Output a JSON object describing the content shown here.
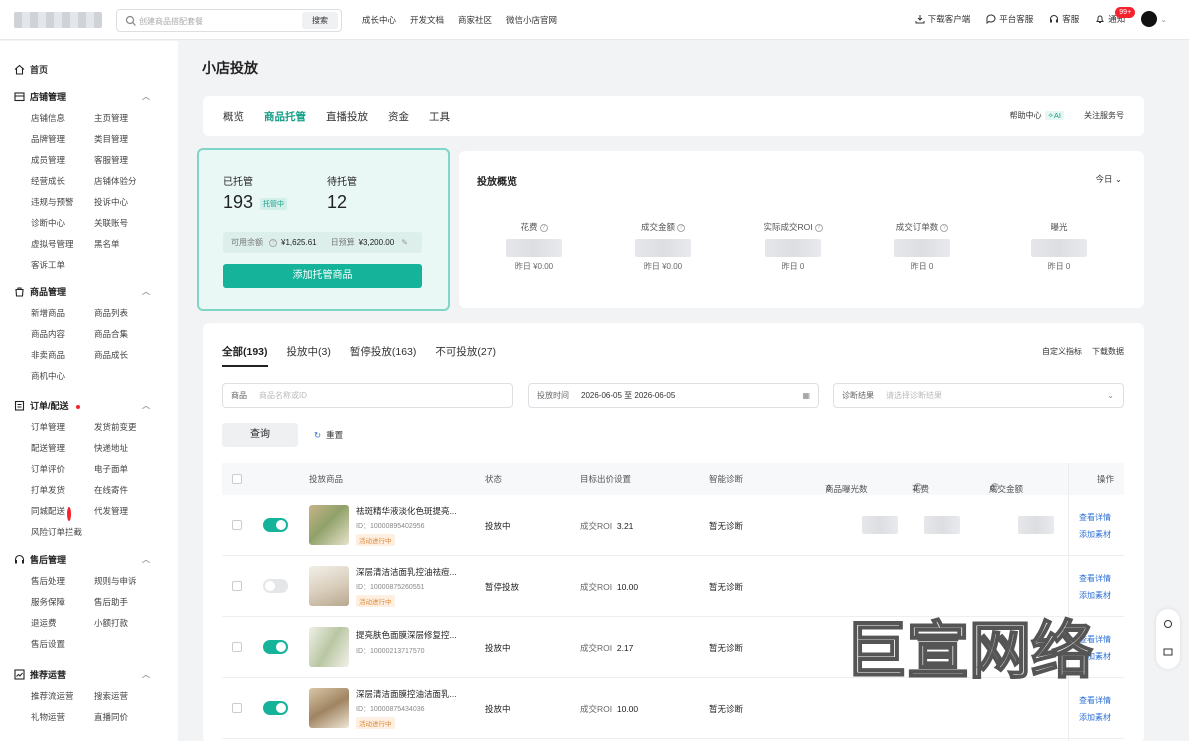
{
  "topbar": {
    "search_placeholder": "创建商品搭配套餐",
    "search_button": "搜索",
    "nav": [
      "成长中心",
      "开发文档",
      "商家社区",
      "微信小店官网"
    ],
    "download_client": "下载客户端",
    "platform_service": "平台客服",
    "service": "客服",
    "notice": "通知",
    "notice_badge": "99+"
  },
  "sidebar": {
    "home": "首页",
    "sections": [
      {
        "title": "店铺管理",
        "items": [
          "店铺信息",
          "主页管理",
          "品牌管理",
          "类目管理",
          "成员管理",
          "客服管理",
          "经营成长",
          "店铺体验分",
          "违规与预警",
          "投诉中心",
          "诊断中心",
          "关联账号",
          "虚拟号管理",
          "黑名单",
          "客诉工单"
        ]
      },
      {
        "title": "商品管理",
        "items": [
          "新增商品",
          "商品列表",
          "商品内容",
          "商品合集",
          "非卖商品",
          "商品成长",
          "商机中心"
        ]
      },
      {
        "title": "订单/配送",
        "items": [
          "订单管理",
          "发货前变更",
          "配送管理",
          "快递地址",
          "订单评价",
          "电子面单",
          "打单发货",
          "在线寄件",
          "同城配送",
          "代发管理",
          "风险订单拦截"
        ]
      },
      {
        "title": "售后管理",
        "items": [
          "售后处理",
          "规则与申诉",
          "服务保障",
          "售后助手",
          "退运费",
          "小额打款",
          "售后设置"
        ]
      },
      {
        "title": "推荐运营",
        "items": [
          "推荐流运营",
          "搜索运营",
          "礼物运营",
          "直播同价"
        ]
      }
    ]
  },
  "page": {
    "title": "小店投放",
    "tabs": [
      "概览",
      "商品托管",
      "直播投放",
      "资金",
      "工具"
    ],
    "help_center": "帮助中心",
    "ai": "AI",
    "follow": "关注服务号"
  },
  "hosted": {
    "label_hosted": "已托管",
    "count_hosted": "193",
    "tag": "托管中",
    "label_pending": "待托管",
    "count_pending": "12",
    "balance_label": "可用余额",
    "balance": "¥1,625.61",
    "budget_label": "日预算",
    "budget": "¥3,200.00",
    "add_button": "添加托管商品"
  },
  "overview": {
    "title": "投放概览",
    "range": "今日",
    "metrics": [
      {
        "label": "花费",
        "yesterday": "昨日 ¥0.00"
      },
      {
        "label": "成交金额",
        "yesterday": "昨日 ¥0.00"
      },
      {
        "label": "实际成交ROI",
        "yesterday": "昨日 0"
      },
      {
        "label": "成交订单数",
        "yesterday": "昨日 0"
      },
      {
        "label": "曝光",
        "yesterday": "昨日 0"
      }
    ]
  },
  "list": {
    "tabs": [
      "全部(193)",
      "投放中(3)",
      "暂停投放(163)",
      "不可投放(27)"
    ],
    "custom_metrics": "自定义指标",
    "download": "下载数据",
    "filter_product_label": "商品",
    "filter_product_placeholder": "商品名称或ID",
    "filter_time_label": "投放时间",
    "filter_time_value": "2026-06-05 至 2026-06-05",
    "filter_diag_label": "诊断结果",
    "filter_diag_placeholder": "请选择诊断结果",
    "query": "查询",
    "reset": "重置",
    "columns": {
      "product": "投放商品",
      "status": "状态",
      "target": "目标出价设置",
      "diagnosis": "智能诊断",
      "exposure": "商品曝光数",
      "cost": "花费",
      "amount": "成交金额",
      "ops": "操作"
    },
    "rows": [
      {
        "name": "祛斑精华液淡化色斑提亮...",
        "id": "ID：10000895402956",
        "tag": "活动进行中",
        "status": "投放中",
        "roi_label": "成交ROI",
        "roi": "3.21",
        "diag": "暂无诊断",
        "on": true,
        "op1": "查看详情",
        "op2": "添加素材"
      },
      {
        "name": "深层清洁洁面乳控油祛痘...",
        "id": "ID：10000875260551",
        "tag": "活动进行中",
        "status": "暂停投放",
        "roi_label": "成交ROI",
        "roi": "10.00",
        "diag": "暂无诊断",
        "on": false,
        "op1": "查看详情",
        "op2": "添加素材"
      },
      {
        "name": "提亮肤色面膜深层修复控...",
        "id": "ID：10000213717570",
        "tag": "",
        "status": "投放中",
        "roi_label": "成交ROI",
        "roi": "2.17",
        "diag": "暂无诊断",
        "on": true,
        "op1": "查看详情",
        "op2": "添加素材"
      },
      {
        "name": "深层清洁面膜控油洁面乳...",
        "id": "ID：10000875434036",
        "tag": "活动进行中",
        "status": "投放中",
        "roi_label": "成交ROI",
        "roi": "10.00",
        "diag": "暂无诊断",
        "on": true,
        "op1": "查看详情",
        "op2": "添加素材"
      }
    ]
  },
  "watermark": "巨宣网络",
  "colors": {
    "accent": "#16b39b",
    "link": "#2a6fd6",
    "badge": "#f5222d"
  }
}
